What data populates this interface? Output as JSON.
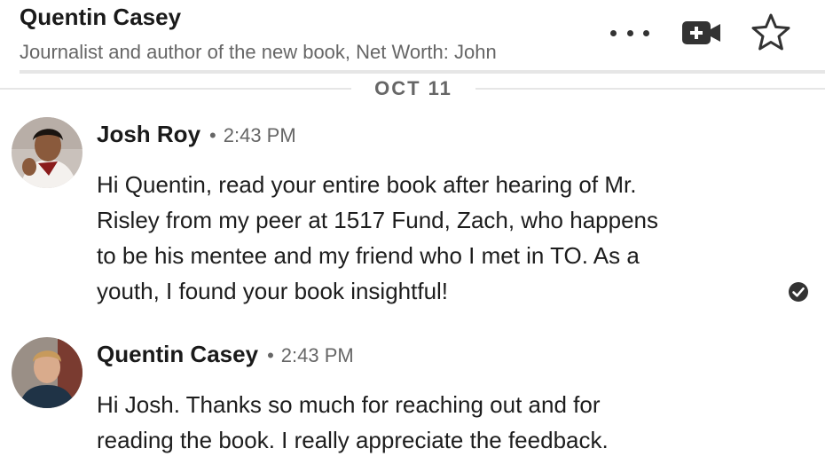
{
  "header": {
    "name": "Quentin Casey",
    "headline": "Journalist and author of the new book, Net Worth: John"
  },
  "icons": {
    "more": "more-horizontal-icon",
    "video": "video-call-icon",
    "star": "star-outline-icon",
    "read": "read-receipt-check-icon"
  },
  "colors": {
    "text": "#1d1d1d",
    "muted": "#666666",
    "divider": "#e6e6e6"
  },
  "date_divider": "OCT 11",
  "messages": [
    {
      "sender": "Josh Roy",
      "separator": "•",
      "time": "2:43 PM",
      "lines": [
        "Hi Quentin, read your entire book after hearing of Mr.",
        "Risley from my peer at 1517 Fund, Zach, who happens",
        "to be his mentee and my friend who I met in TO. As a",
        "youth, I found your book insightful!"
      ]
    },
    {
      "sender": "Quentin Casey",
      "separator": "•",
      "time": "2:43 PM",
      "lines": [
        "Hi Josh. Thanks so much for reaching out and for",
        "reading the book. I really appreciate the feedback."
      ]
    }
  ]
}
